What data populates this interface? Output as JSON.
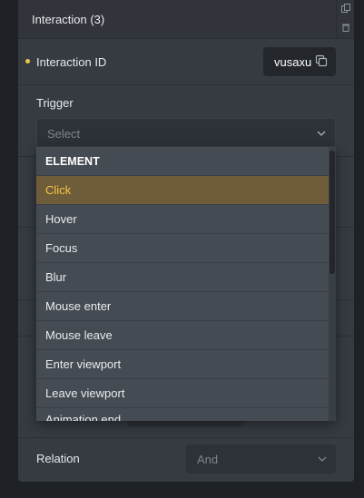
{
  "panel": {
    "title": "Interaction (3)",
    "actions": [
      "duplicate-icon",
      "trash-icon"
    ]
  },
  "interaction_id": {
    "label": "Interaction ID",
    "value": "vusaxu"
  },
  "trigger": {
    "label": "Trigger",
    "placeholder": "Select"
  },
  "dropdown": {
    "group": "ELEMENT",
    "items": [
      "Click",
      "Hover",
      "Focus",
      "Blur",
      "Mouse enter",
      "Mouse leave",
      "Enter viewport",
      "Leave viewport",
      "Animation end"
    ],
    "active": "Click"
  },
  "relation": {
    "label": "Relation",
    "value": "And"
  },
  "colors": {
    "accent": "#f7c644",
    "panel": "#363b42",
    "dropdown": "#454b53",
    "active_bg": "#6e5c3a"
  }
}
